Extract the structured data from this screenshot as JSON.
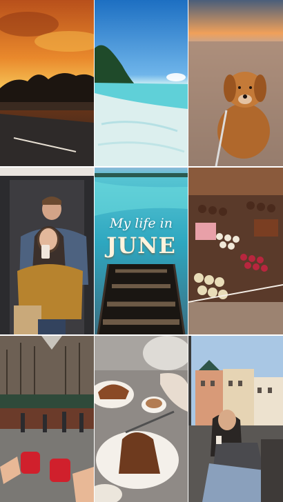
{
  "collage": {
    "tiles": [
      {
        "id": "sunset-road",
        "icon": "sunset-photo"
      },
      {
        "id": "tropical-beach",
        "icon": "beach-photo"
      },
      {
        "id": "golden-retriever",
        "icon": "dog-photo"
      },
      {
        "id": "couple-selfie",
        "icon": "mirror-selfie-photo"
      },
      {
        "id": "title-card",
        "icon": "dock-photo"
      },
      {
        "id": "chocolate-display",
        "icon": "chocolates-photo"
      },
      {
        "id": "cathedral-market",
        "icon": "cathedral-photo"
      },
      {
        "id": "cafe-dessert",
        "icon": "crepe-photo"
      },
      {
        "id": "city-cafe",
        "icon": "street-cafe-photo"
      }
    ],
    "title": {
      "script": "My life in",
      "month": "JUNE"
    }
  },
  "colors": {
    "sky_orange": "#f0a13c",
    "ocean_turquoise": "#3fbfcf",
    "title_cream": "#fff3dd"
  }
}
